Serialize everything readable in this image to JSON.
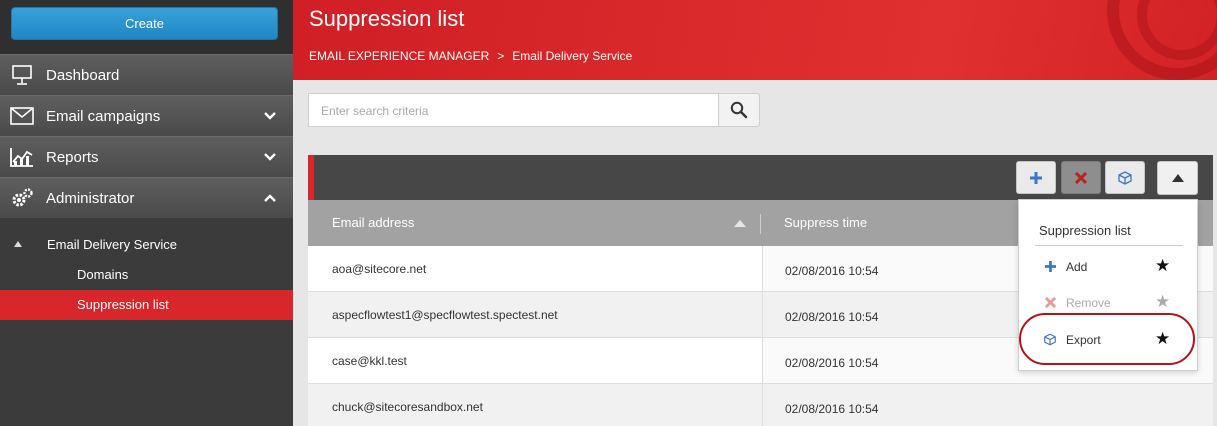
{
  "sidebar": {
    "create_label": "Create",
    "nav": [
      {
        "label": "Dashboard",
        "icon": "dashboard-icon"
      },
      {
        "label": "Email campaigns",
        "icon": "envelope-icon",
        "expanded": false
      },
      {
        "label": "Reports",
        "icon": "reports-chart-icon",
        "expanded": false
      },
      {
        "label": "Administrator",
        "icon": "gears-icon",
        "expanded": true
      }
    ],
    "tree": {
      "parent": "Email Delivery Service",
      "children": [
        {
          "label": "Domains",
          "active": false
        },
        {
          "label": "Suppression list",
          "active": true
        }
      ]
    }
  },
  "header": {
    "title": "Suppression list",
    "breadcrumb": [
      "EMAIL EXPERIENCE MANAGER",
      "Email Delivery Service"
    ],
    "breadcrumb_sep": ">"
  },
  "search": {
    "placeholder": "Enter search criteria"
  },
  "table": {
    "columns": [
      "Email address",
      "Suppress time"
    ],
    "sort": "ascending",
    "rows": [
      {
        "email": "aoa@sitecore.net",
        "time": "02/08/2016 10:54"
      },
      {
        "email": "aspecflowtest1@specflowtest.spectest.net",
        "time": "02/08/2016 10:54"
      },
      {
        "email": "case@kkl.test",
        "time": "02/08/2016 10:54"
      },
      {
        "email": "chuck@sitecoresandbox.net",
        "time": "02/08/2016 10:54"
      }
    ]
  },
  "dropdown": {
    "title": "Suppression list",
    "items": [
      {
        "label": "Add",
        "icon": "plus-icon",
        "enabled": true
      },
      {
        "label": "Remove",
        "icon": "remove-x-icon",
        "enabled": false
      },
      {
        "label": "Export",
        "icon": "export-box-icon",
        "enabled": true,
        "highlighted": true
      }
    ]
  },
  "colors": {
    "accent_red": "#d8262b",
    "create_blue": "#2a93cf",
    "sidebar_bg": "#3b3b3b"
  }
}
